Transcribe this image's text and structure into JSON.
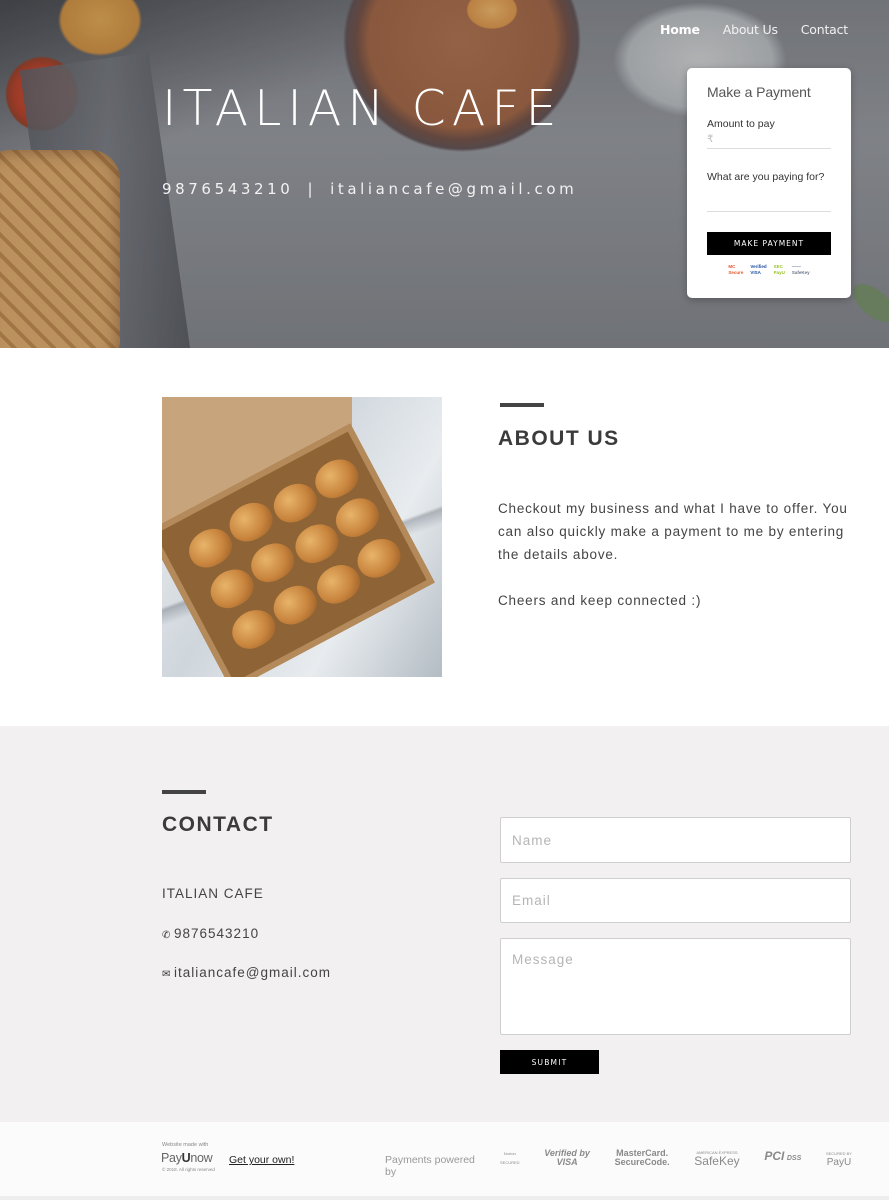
{
  "nav": {
    "items": [
      {
        "label": "Home",
        "active": true
      },
      {
        "label": "About Us",
        "active": false
      },
      {
        "label": "Contact",
        "active": false
      }
    ]
  },
  "hero": {
    "title": "ITALIAN CAFE",
    "phone": "9876543210",
    "separator": "|",
    "email": "italiancafe@gmail.com"
  },
  "payment_card": {
    "title": "Make a Payment",
    "amount_label": "Amount to pay",
    "amount_currency": "₹",
    "amount_value": "",
    "purpose_label": "What are you paying for?",
    "purpose_value": "",
    "button_label": "MAKE PAYMENT",
    "logos": [
      "Mastercard SecureCode",
      "Verified by VISA",
      "Secured by PayU",
      "SafeKey"
    ]
  },
  "about": {
    "heading": "ABOUT US",
    "paragraphs": [
      "Checkout my business and what I have to offer. You can also quickly make a payment to me by entering the details above.",
      "Cheers and keep connected :)"
    ],
    "image_alt": "box of croissants on marble"
  },
  "contact": {
    "heading": "CONTACT",
    "business_name": "ITALIAN CAFE",
    "phone": "9876543210",
    "email": "italiancafe@gmail.com",
    "phone_icon": "phone-icon",
    "email_icon": "envelope-icon",
    "form": {
      "name_placeholder": "Name",
      "email_placeholder": "Email",
      "message_placeholder": "Message",
      "submit_label": "SUBMIT"
    }
  },
  "footer": {
    "made_with": "Website made with",
    "brand_pre": "Pay",
    "brand_bold": "U",
    "brand_post": "now",
    "copyright": "© 2018. All rights reserved",
    "get_own_link": "Get your own!",
    "powered_by": "Payments powered by",
    "badges": [
      {
        "name": "Norton Secured",
        "line1": "Norton",
        "line2": "SECURED"
      },
      {
        "name": "Verified by VISA",
        "line1": "Verified by",
        "line2": "VISA"
      },
      {
        "name": "MasterCard SecureCode",
        "line1": "MasterCard.",
        "line2": "SecureCode."
      },
      {
        "name": "American Express SafeKey",
        "line1": "AMERICAN EXPRESS",
        "line2": "SafeKey"
      },
      {
        "name": "PCI DSS",
        "line1": "PCI",
        "line2": "DSS"
      },
      {
        "name": "Secured by PayU",
        "line1": "SECURED BY",
        "line2": "PayU"
      }
    ]
  },
  "colors": {
    "button_bg": "#000000",
    "contact_bg": "#f2f0f1",
    "footer_bg": "#fbfbfb",
    "heading_text": "#3b3b3b"
  }
}
